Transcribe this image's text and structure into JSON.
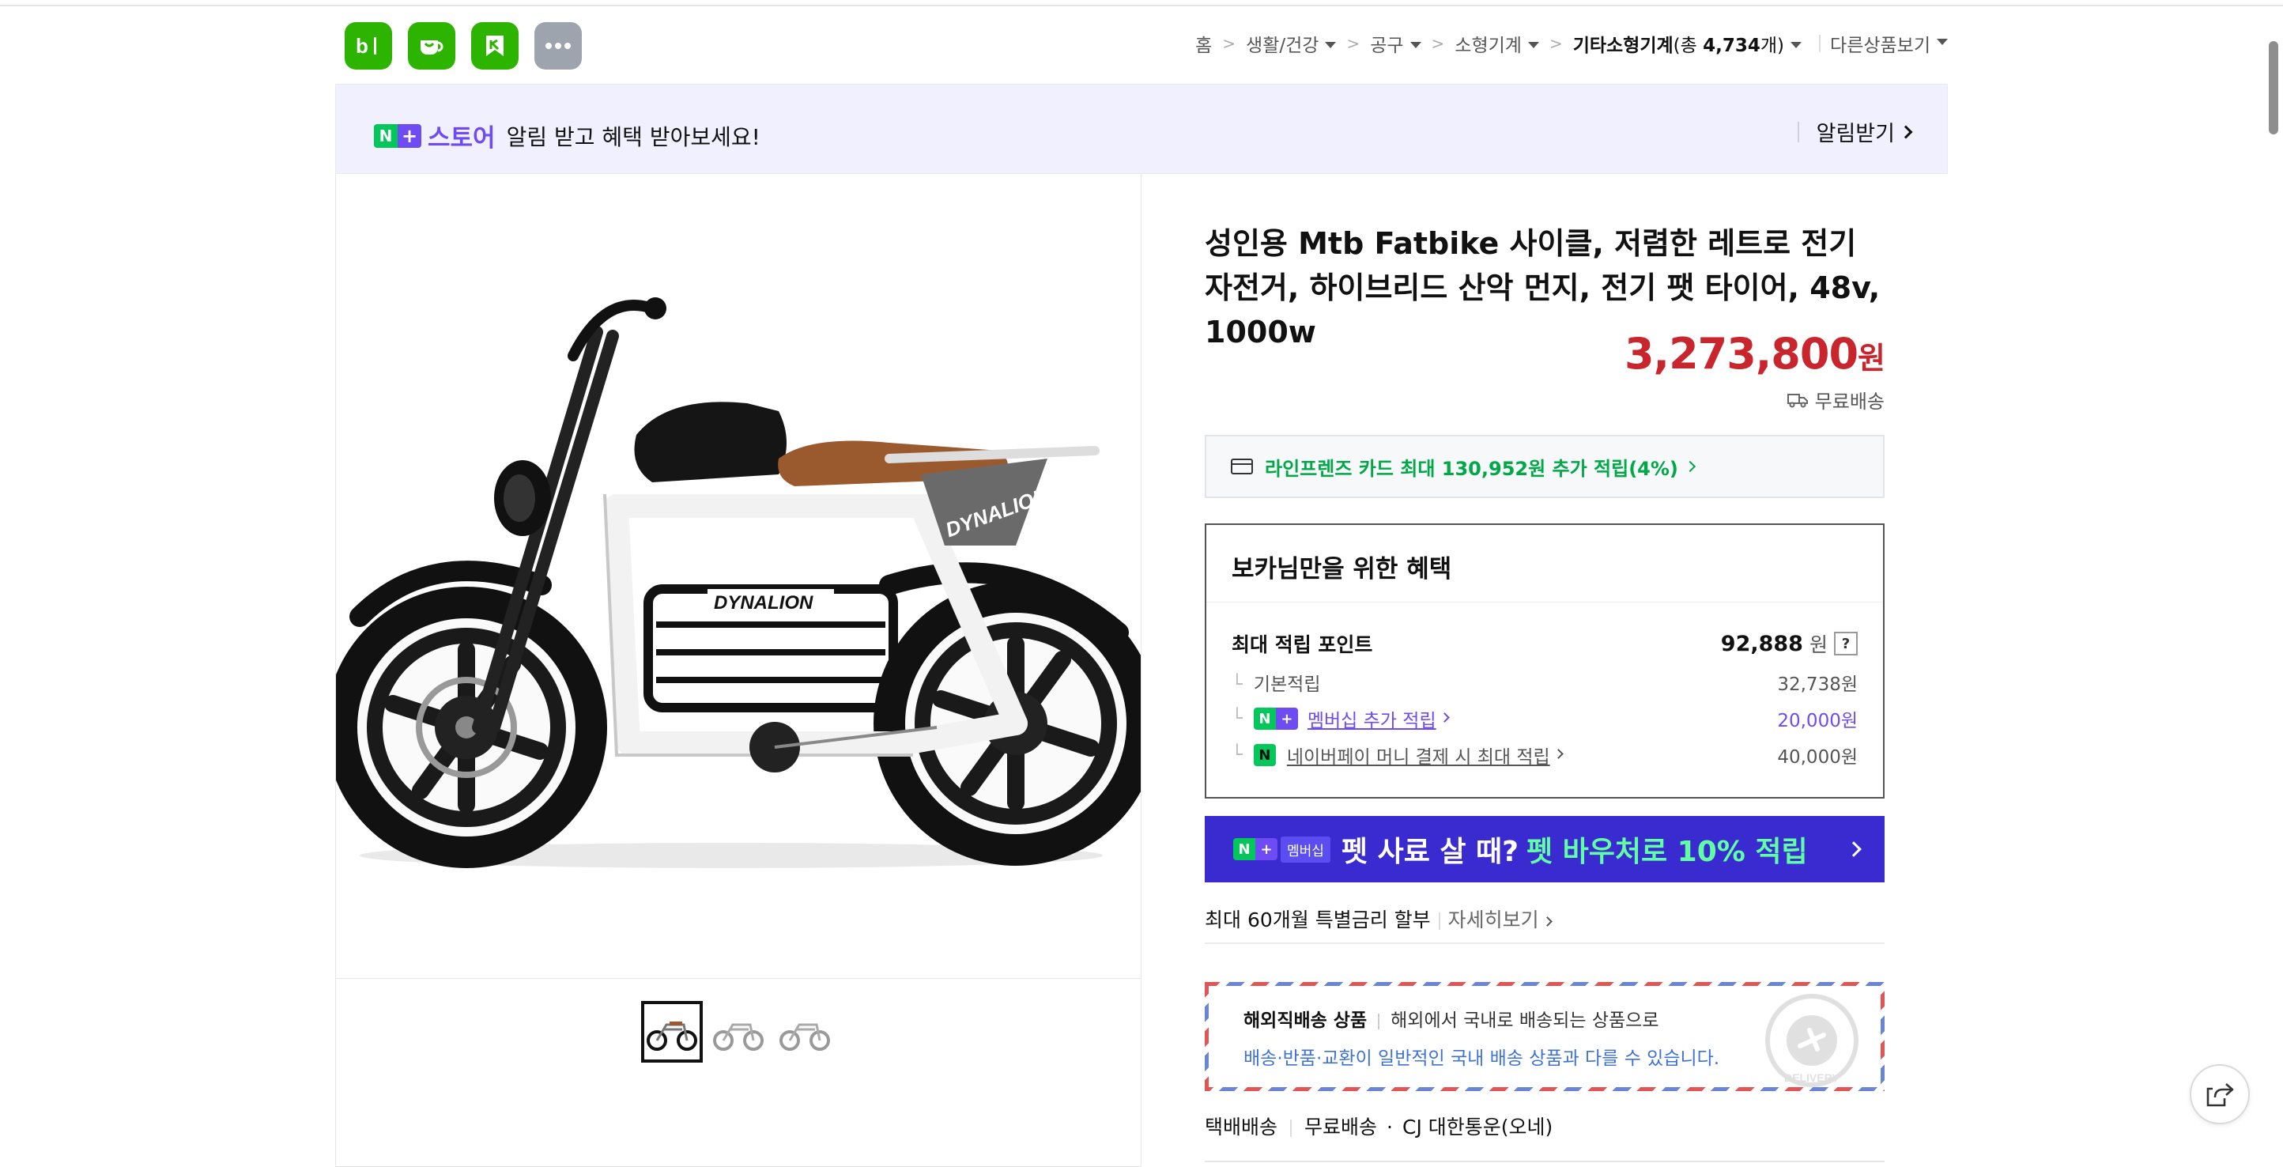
{
  "header": {
    "apps": [
      {
        "name": "blog-app",
        "label": "b|"
      },
      {
        "name": "cafe-app",
        "label": ""
      },
      {
        "name": "bookmark-app",
        "label": ""
      },
      {
        "name": "more-apps",
        "label": "···"
      }
    ],
    "breadcrumb": {
      "home": "홈",
      "items": [
        "생활/건강",
        "공구",
        "소형기계"
      ],
      "current": "기타소형기계",
      "count_prefix": "(총 ",
      "count_value": "4,734",
      "count_suffix": "개)",
      "other_link": "다른상품보기"
    }
  },
  "banner": {
    "badge_n": "N",
    "badge_plus": "+",
    "store": "스토어",
    "message": "알림 받고 혜택 받아보세요!",
    "action": "알림받기"
  },
  "product": {
    "title": "성인용 Mtb Fatbike 사이클, 저렴한 레트로 전기 자전거, 하이브리드 산악 먼지, 전기 팻 타이어, 48v, 1000w",
    "price": "3,273,800",
    "currency": "원",
    "shipping": "무료배송",
    "image_brand": "DYNALION",
    "thumbnails": 3,
    "selected_thumbnail": 1
  },
  "card_promo": {
    "text": "라인프렌즈 카드 최대 130,952원 추가 적립(4%)"
  },
  "benefits": {
    "heading": "보카님만을 위한 혜택",
    "max_points_label": "최대 적립 포인트",
    "max_points_value": "92,888",
    "max_points_unit": "원",
    "help": "?",
    "basic_label": "기본적립",
    "basic_value": "32,738원",
    "membership_label": "멤버십 추가 적립",
    "membership_value": "20,000원",
    "npay_label": "네이버페이 머니 결제 시 최대 적립",
    "npay_value": "40,000원",
    "npay_icon_text": "N"
  },
  "pet_banner": {
    "badge": "멤버십",
    "text1": "펫 사료 살 때?",
    "text2": "펫 바우처로 10% 적립"
  },
  "installment": {
    "label": "최대 60개월 특별금리 할부",
    "link": "자세히보기"
  },
  "overseas": {
    "title": "해외직배송 상품",
    "desc": "해외에서 국내로 배송되는 상품으로",
    "note": "배송·반품·교환이 일반적인 국내 배송 상품과 다를 수 있습니다.",
    "stamp_text": "DELIVERY"
  },
  "delivery": {
    "method": "택배배송",
    "fee": "무료배송",
    "dot": "·",
    "carrier": "CJ 대한통운(오네)"
  },
  "colors": {
    "naver_green": "#03c75a",
    "purple": "#6e4bf2",
    "price_red": "#c8252c",
    "pet_blue": "#3a2bd1",
    "mint": "#61ffa4"
  }
}
